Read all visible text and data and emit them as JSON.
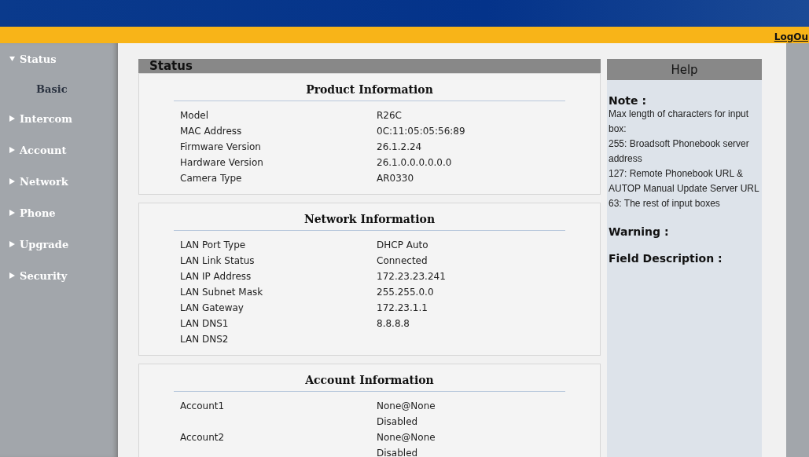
{
  "header": {
    "logout_link": "LogOu"
  },
  "sidebar": {
    "items": [
      {
        "label": "Status",
        "expanded": true,
        "children": [
          {
            "label": "Basic",
            "selected": true
          }
        ]
      },
      {
        "label": "Intercom",
        "expanded": false
      },
      {
        "label": "Account",
        "expanded": false
      },
      {
        "label": "Network",
        "expanded": false
      },
      {
        "label": "Phone",
        "expanded": false
      },
      {
        "label": "Upgrade",
        "expanded": false
      },
      {
        "label": "Security",
        "expanded": false
      }
    ]
  },
  "status_panel": {
    "title": "Status",
    "sections": [
      {
        "title": "Product Information",
        "rows": [
          [
            "Model",
            "R26C"
          ],
          [
            "MAC Address",
            "0C:11:05:05:56:89"
          ],
          [
            "Firmware Version",
            "26.1.2.24"
          ],
          [
            "Hardware Version",
            "26.1.0.0.0.0.0.0"
          ],
          [
            "Camera Type",
            "AR0330"
          ]
        ]
      },
      {
        "title": "Network Information",
        "rows": [
          [
            "LAN Port Type",
            "DHCP Auto"
          ],
          [
            "LAN Link Status",
            "Connected"
          ],
          [
            "LAN IP Address",
            "172.23.23.241"
          ],
          [
            "LAN Subnet Mask",
            "255.255.0.0"
          ],
          [
            "LAN Gateway",
            "172.23.1.1"
          ],
          [
            "LAN DNS1",
            "8.8.8.8"
          ],
          [
            "LAN DNS2",
            ""
          ]
        ]
      },
      {
        "title": "Account Information",
        "rows": [
          [
            "Account1",
            "None@None"
          ],
          [
            "",
            "Disabled"
          ],
          [
            "Account2",
            "None@None"
          ],
          [
            "",
            "Disabled"
          ]
        ]
      }
    ]
  },
  "help_panel": {
    "title": "Help",
    "blocks": [
      {
        "heading": "Note :",
        "lines": [
          "Max length of characters for input",
          "box:",
          "255: Broadsoft Phonebook server",
          "address",
          "127: Remote Phonebook URL &",
          "AUTOP Manual Update Server URL",
          "63: The rest of input boxes"
        ]
      },
      {
        "heading": "Warning :"
      },
      {
        "heading": "Field Description :"
      }
    ]
  }
}
